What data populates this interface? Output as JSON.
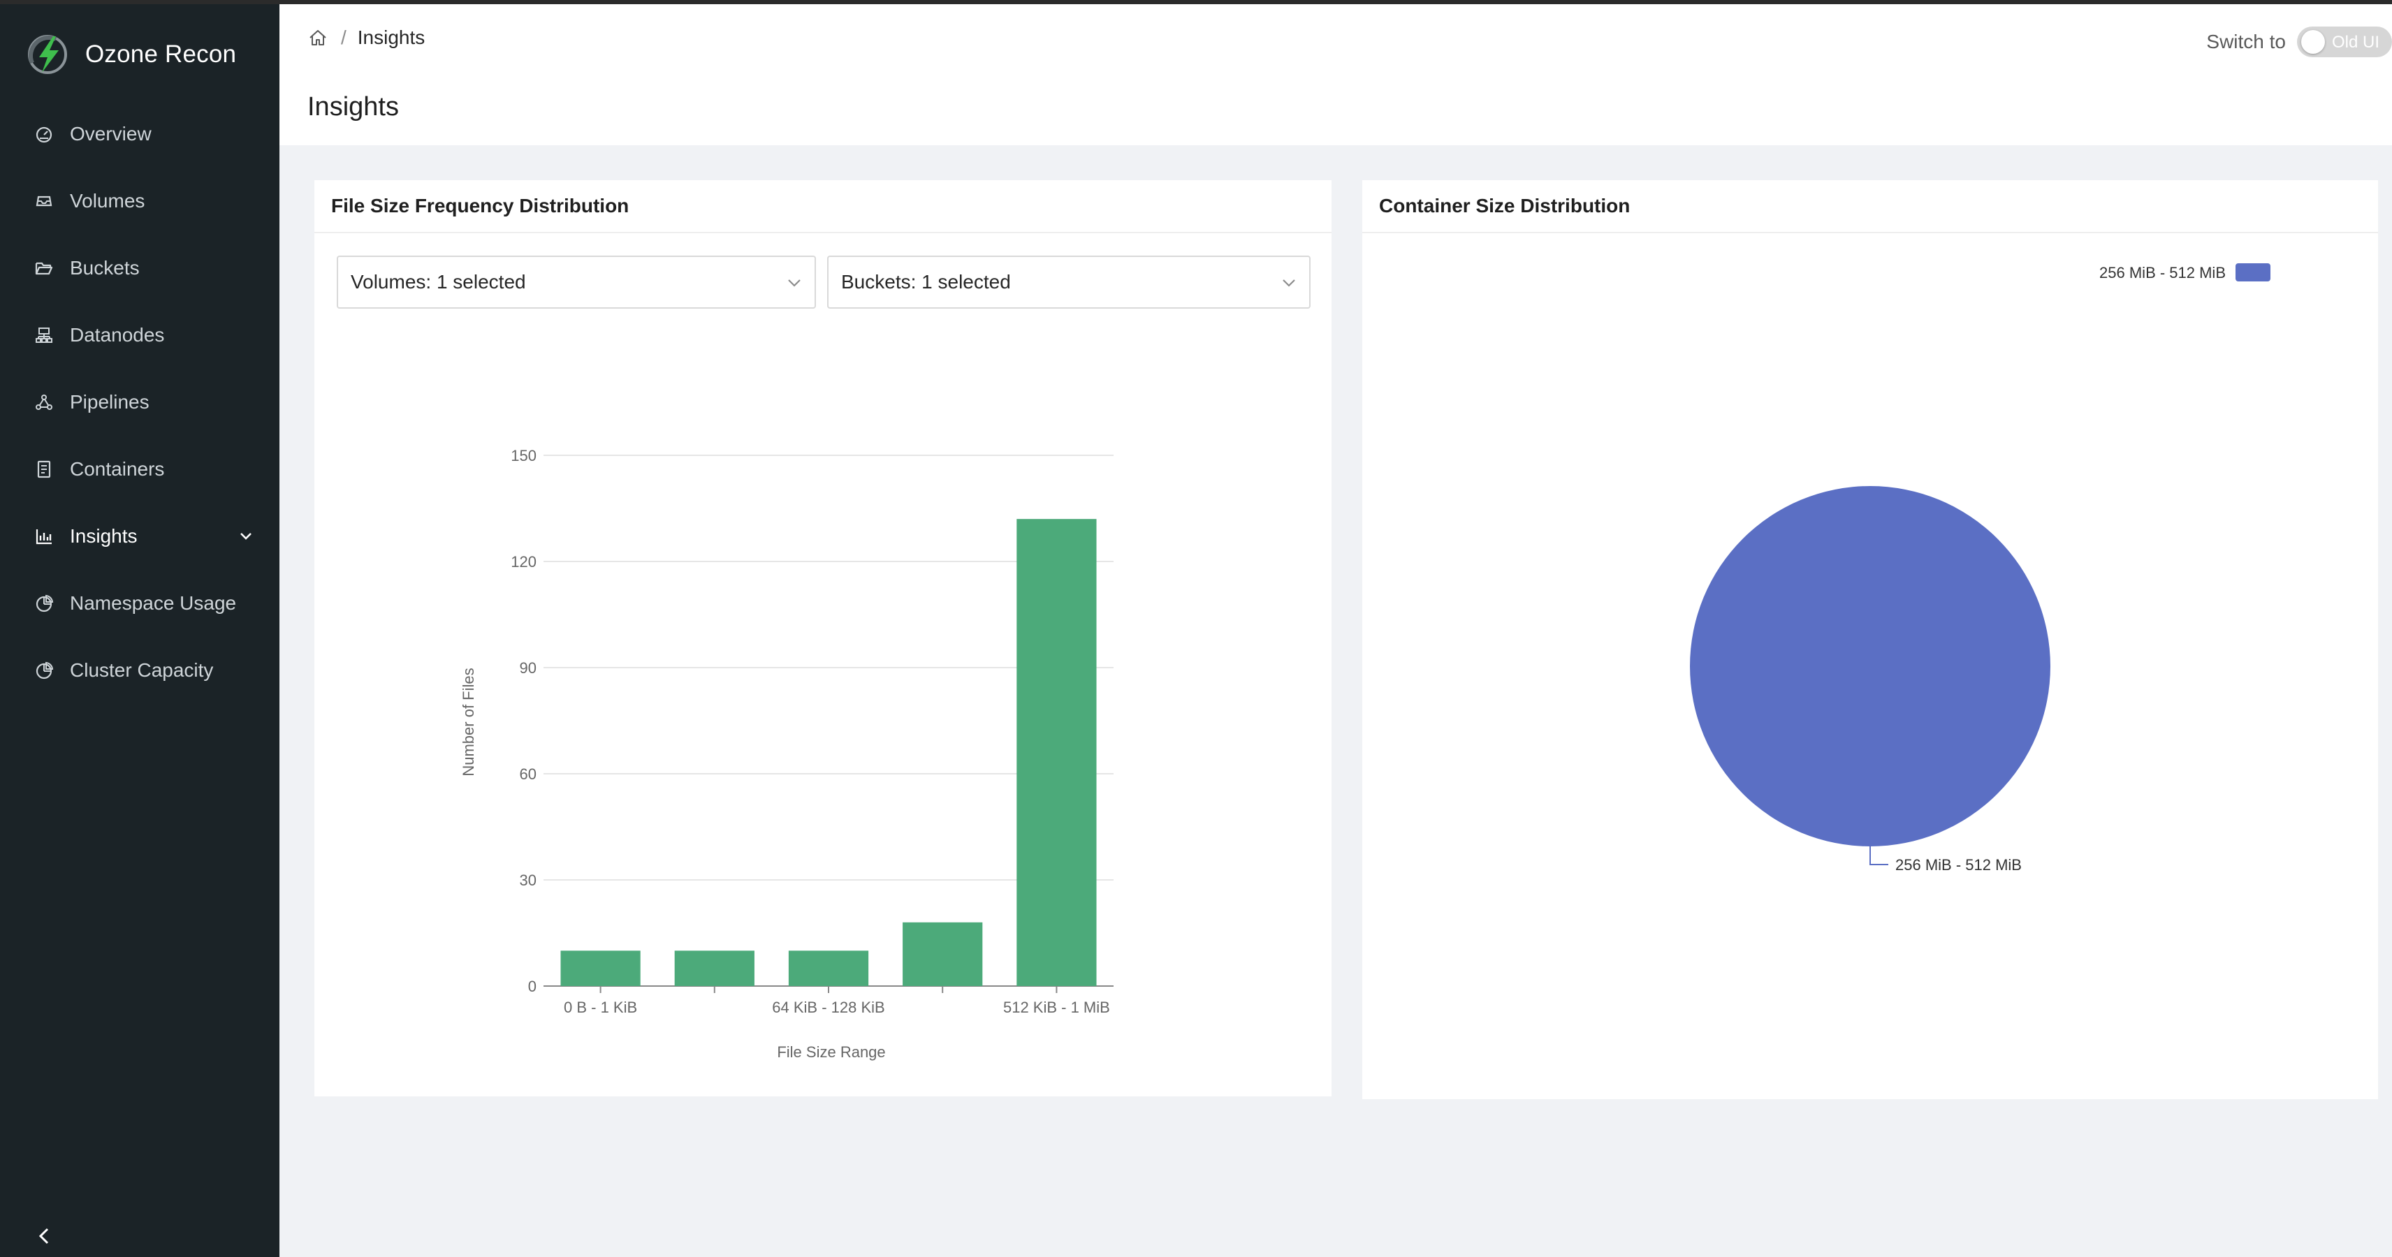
{
  "app": {
    "name": "Ozone Recon"
  },
  "sidebar": {
    "items": [
      {
        "label": "Overview",
        "icon": "dashboard-icon"
      },
      {
        "label": "Volumes",
        "icon": "inbox-icon"
      },
      {
        "label": "Buckets",
        "icon": "folder-open-icon"
      },
      {
        "label": "Datanodes",
        "icon": "cluster-icon"
      },
      {
        "label": "Pipelines",
        "icon": "deployment-unit-icon"
      },
      {
        "label": "Containers",
        "icon": "container-icon"
      },
      {
        "label": "Insights",
        "icon": "bar-chart-icon",
        "active": true,
        "expandable": true
      },
      {
        "label": "Namespace Usage",
        "icon": "pie-chart-icon"
      },
      {
        "label": "Cluster Capacity",
        "icon": "pie-chart-icon"
      }
    ]
  },
  "header": {
    "breadcrumb": [
      "Insights"
    ],
    "title": "Insights",
    "switch_label": "Switch to",
    "toggle_text": "Old UI"
  },
  "file_size_card": {
    "title": "File Size Frequency Distribution",
    "volumes_select": "Volumes: 1 selected",
    "buckets_select": "Buckets: 1 selected"
  },
  "container_card": {
    "title": "Container Size Distribution"
  },
  "colors": {
    "bar": "#4caa7a",
    "pie": "#5b6fc4",
    "sidebar": "#1b2327"
  },
  "chart_data": [
    {
      "type": "bar",
      "xlabel": "File Size Range",
      "ylabel": "Number of Files",
      "ylim": [
        0,
        150
      ],
      "yticks": [
        0,
        30,
        60,
        90,
        120,
        150
      ],
      "categories": [
        "0 B - 1 KiB",
        "",
        "64 KiB - 128 KiB",
        "",
        "512 KiB - 1 MiB"
      ],
      "values": [
        10,
        10,
        10,
        18,
        132
      ],
      "grid": true
    },
    {
      "type": "pie",
      "labels": [
        "256 MiB - 512 MiB"
      ],
      "values": [
        100
      ],
      "legend": "top-right"
    }
  ]
}
